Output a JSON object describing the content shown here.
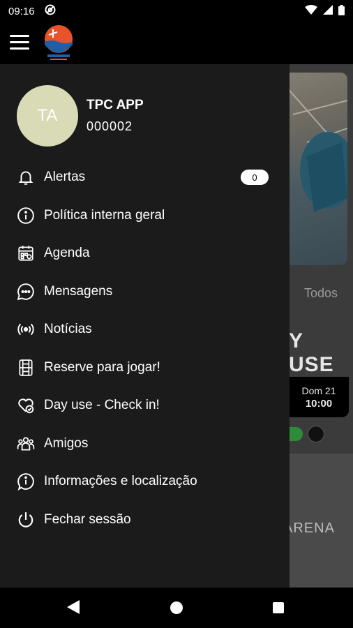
{
  "status_bar": {
    "time": "09:16",
    "icons": [
      "at-sign-icon",
      "wifi-icon",
      "signal-icon",
      "battery-icon"
    ]
  },
  "app_bar": {
    "menu_icon": "hamburger-icon",
    "logo_name": "beach-tennis-logo"
  },
  "profile": {
    "initials": "TA",
    "name": "TPC APP",
    "id": "000002",
    "avatar_color": "#d8dbb6"
  },
  "menu": {
    "items": [
      {
        "label": "Alertas",
        "icon": "bell-icon",
        "badge": "0"
      },
      {
        "label": "Política interna geral",
        "icon": "info-icon"
      },
      {
        "label": "Agenda",
        "icon": "calendar-icon"
      },
      {
        "label": "Mensagens",
        "icon": "chat-icon"
      },
      {
        "label": "Notícias",
        "icon": "broadcast-icon"
      },
      {
        "label": "Reserve para jogar!",
        "icon": "court-icon"
      },
      {
        "label": "Day use - Check in!",
        "icon": "heart-check-icon"
      },
      {
        "label": "Amigos",
        "icon": "friends-icon"
      },
      {
        "label": "Informações e localização",
        "icon": "info-location-icon"
      },
      {
        "label": "Fechar sessão",
        "icon": "power-icon"
      }
    ]
  },
  "background": {
    "tab_label": "Todos",
    "title_fragment": "Y USE",
    "card_day": "Dom 21",
    "card_time": "10:00",
    "arena_fragment": "ARENA"
  },
  "colors": {
    "drawer_bg": "#1b1b1b",
    "accent_green": "#2e8b3a",
    "logo_orange": "#e8532b"
  }
}
